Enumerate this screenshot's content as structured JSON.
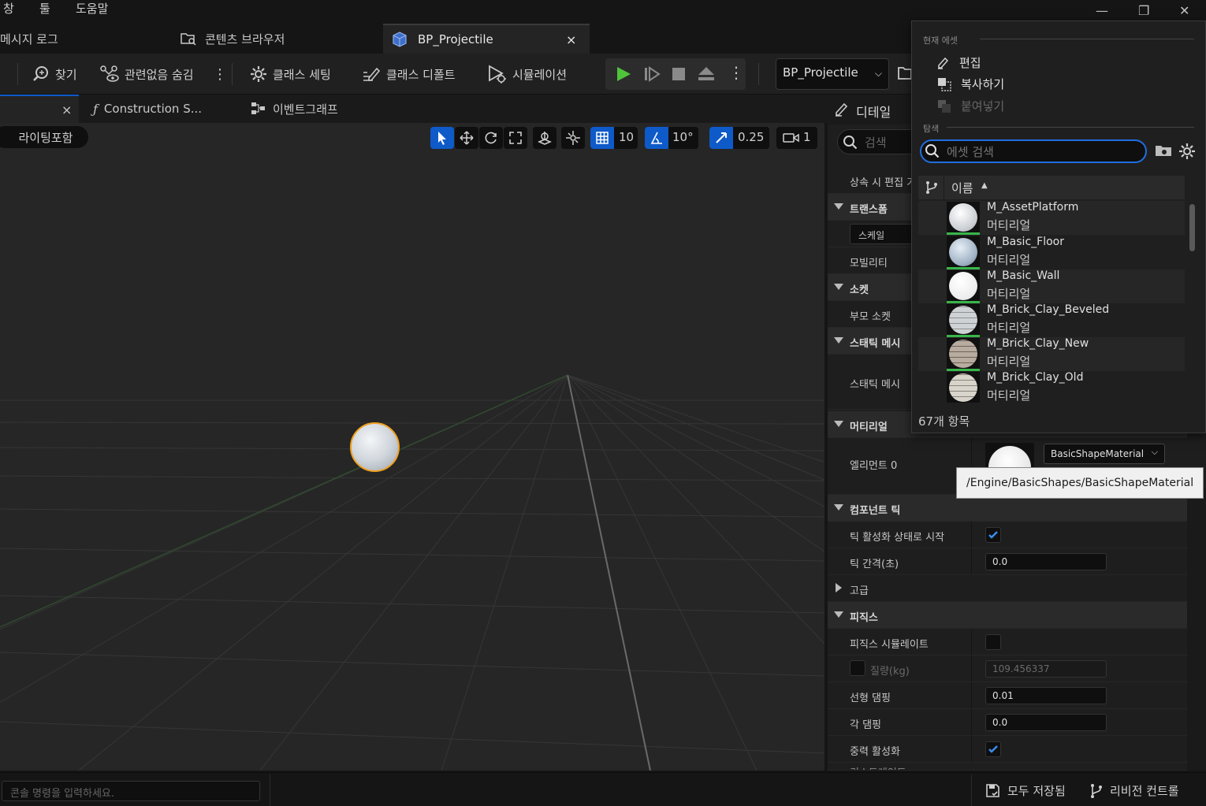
{
  "menu": {
    "items": [
      "창",
      "툴",
      "도움말"
    ]
  },
  "tabs": {
    "message_log": "메시지 로그",
    "content_browser": "콘텐츠 브라우저",
    "bp_projectile": "BP_Projectile",
    "close": "×"
  },
  "toolbar": {
    "find": "찾기",
    "hide_unrelated": "관련없음 숨김",
    "class_settings": "클래스 세팅",
    "class_defaults": "클래스 디폴트",
    "simulation": "시뮬레이션",
    "debug_object": "BP_Projectile"
  },
  "editor_tabs": {
    "close": "×",
    "construction": "Construction S...",
    "event_graph": "이벤트그래프"
  },
  "viewport": {
    "lighting": "라이팅포함",
    "grid_snap": "10",
    "rotate_snap": "10°",
    "scale_snap": "0.25",
    "camera_speed": "1"
  },
  "details": {
    "title": "디테일",
    "search_placeholder": "검색",
    "rows": {
      "inherit_edit": "상속 시 편집 가",
      "transform": "트랜스폼",
      "scale": "스케일",
      "mobility": "모빌리티",
      "sockets": "소켓",
      "parent_socket": "부모 소켓",
      "static_mesh_cat": "스태틱 메시",
      "static_mesh": "스태틱 메시",
      "materials": "머티리얼",
      "element0": "엘리먼트 0",
      "component_tick": "컴포넌트 틱",
      "tick_start": "틱 활성화 상태로 시작",
      "tick_interval": "틱 간격(초)",
      "advanced": "고급",
      "physics": "피직스",
      "simulate_physics": "피직스 시뮬레이트",
      "mass": "질량(kg)",
      "linear_damping": "선형 댐핑",
      "angular_damping": "각 댐핑",
      "enable_gravity": "중력 활성화",
      "constraints": "컨스트레인트"
    },
    "values": {
      "tick_interval": "0.0",
      "mass": "109.456337",
      "linear_damping": "0.01",
      "angular_damping": "0.0"
    },
    "material_combo": "BasicShapeMaterial"
  },
  "tooltip": {
    "path": "/Engine/BasicShapes/BasicShapeMaterial"
  },
  "popup": {
    "current_asset_header": "현재 에셋",
    "edit": "편집",
    "copy": "복사하기",
    "paste": "붙여넣기",
    "browse_header": "탐색",
    "search_placeholder": "에셋 검색",
    "column_name": "이름",
    "item_count": "67개 항목",
    "assets": [
      {
        "name": "M_AssetPlatform",
        "type": "머티리얼"
      },
      {
        "name": "M_Basic_Floor",
        "type": "머티리얼"
      },
      {
        "name": "M_Basic_Wall",
        "type": "머티리얼"
      },
      {
        "name": "M_Brick_Clay_Beveled",
        "type": "머티리얼"
      },
      {
        "name": "M_Brick_Clay_New",
        "type": "머티리얼"
      },
      {
        "name": "M_Brick_Clay_Old",
        "type": "머티리얼"
      }
    ]
  },
  "statusbar": {
    "console_placeholder": "콘솔 명령을 입력하세요.",
    "save_all": "모두 저장됨",
    "revision_control": "리비전 컨트롤"
  },
  "colors": {
    "accent_blue": "#0e5ac9",
    "play_green": "#4fc33a",
    "selection_orange": "#f0a020"
  }
}
